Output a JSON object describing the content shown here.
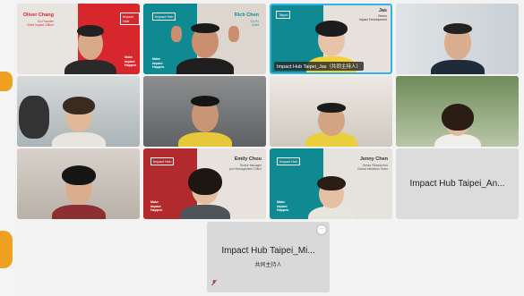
{
  "brand": {
    "box": "Impact Hub",
    "tagline_lines": [
      "Make",
      "Impact",
      "Happen."
    ]
  },
  "tiles": [
    {
      "label": "",
      "name_card": {
        "name": "Oliver Chang",
        "title_lines": [
          "Co-Founder",
          "Chief Impact Officer"
        ],
        "box": "Impact Hub"
      }
    },
    {
      "label": "",
      "name_card": {
        "name": "Rich Chen",
        "title_lines": [
          "Co-Fo",
          "Chief"
        ],
        "box": "Impact Hub"
      }
    },
    {
      "label": "Impact Hub Taipei_Jas（共同主持人）",
      "name_card": {
        "name": "Jas",
        "title_lines": [
          "Senior",
          "Impact Development"
        ],
        "box": "Taipei"
      }
    },
    {
      "label": ""
    },
    {
      "label": ""
    },
    {
      "label": ""
    },
    {
      "label": ""
    },
    {
      "label": ""
    },
    {
      "label": ""
    },
    {
      "label": "",
      "name_card": {
        "name": "Emily Chou",
        "title_lines": [
          "Senior Manager",
          "ject Management Office"
        ],
        "box": "Impact Hub"
      }
    },
    {
      "label": "",
      "name_card": {
        "name": "Jenny Chen",
        "title_lines": [
          "Senior Researcher",
          "Global Initiatives Team"
        ],
        "box": "Impact Hub"
      }
    },
    {
      "label": "Impact Hub Taipei_An..."
    }
  ],
  "featured": {
    "name": "Impact Hub Taipei_Mi...",
    "role": "共同主持人",
    "more": "···"
  },
  "colors": {
    "red": "#d8262d",
    "teal": "#0f8a92",
    "active_border": "#2fb3e8"
  }
}
